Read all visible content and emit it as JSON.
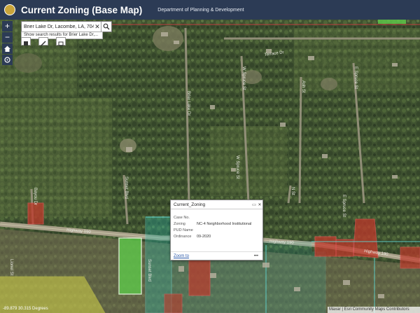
{
  "header": {
    "title": "Current Zoning (Base Map)",
    "subtitle": "Department of Planning & Development"
  },
  "controls": {
    "zoom_in": "+",
    "zoom_out": "−"
  },
  "search": {
    "value": "Brier Lake Dr, Lacombe, LA, 704",
    "clear": "✕",
    "suggestion": "Show search results for Brier Lake Dr,..."
  },
  "roads": {
    "terrace_dr": "Terrace Dr",
    "brier_lake_dr": "Brier Lake Dr",
    "w_spruce_st": "W Spruce St",
    "e_spruce_st": "E Spruce St",
    "ash_st": "Ash St",
    "bayou_dr": "Bayou Dr",
    "n_street": "N St",
    "highway_190": "Highway 190",
    "highway_190_east": "Highway 190",
    "sunset_blvd": "Sunset Blvd",
    "lionel_st": "Lionel St"
  },
  "popup": {
    "title": "Current_Zoning",
    "buttons": {
      "minimize": "▭",
      "close": "✕"
    },
    "fields": [
      {
        "label": "Case No.",
        "value": ""
      },
      {
        "label": "Zoning",
        "value": "NC-4 Neighborhood Institutional"
      },
      {
        "label": "PUD Name",
        "value": ""
      },
      {
        "label": "Ordinance",
        "value": "09-2020"
      }
    ],
    "zoom_to": "Zoom to",
    "more": "•••"
  },
  "status": {
    "coordinates": "-89.879 30.315 Degrees",
    "attribution": "Maxar | Esri Community Maps Contributors"
  },
  "colors": {
    "header": "#2c3b55",
    "zone_commercial": "#c0392b",
    "zone_institutional": "#5ec94a",
    "zone_teal": "#2ab8a8",
    "zone_yellow": "#d6d64a",
    "parcel_outline": "#5fd6d0"
  }
}
